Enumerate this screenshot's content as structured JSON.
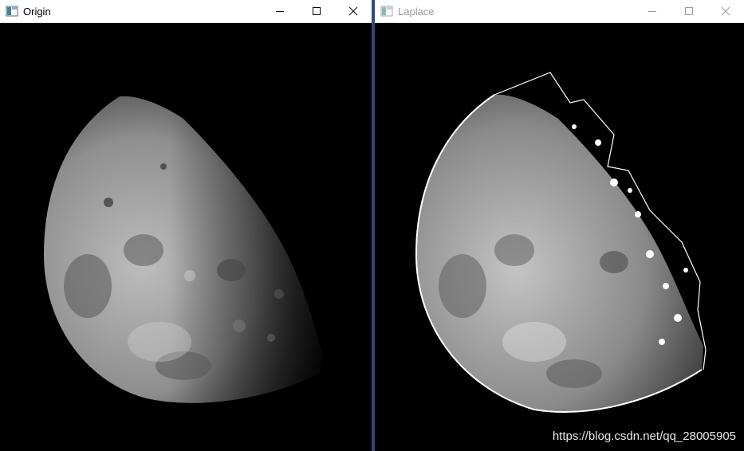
{
  "windows": [
    {
      "title": "Origin",
      "icon": "window-app-icon",
      "controls": [
        "minimize-icon",
        "maximize-icon",
        "close-icon"
      ]
    },
    {
      "title": "Laplace",
      "icon": "window-app-icon",
      "controls": [
        "minimize-icon",
        "maximize-icon",
        "close-icon"
      ]
    }
  ],
  "watermark": "https://blog.csdn.net/qq_28005905"
}
